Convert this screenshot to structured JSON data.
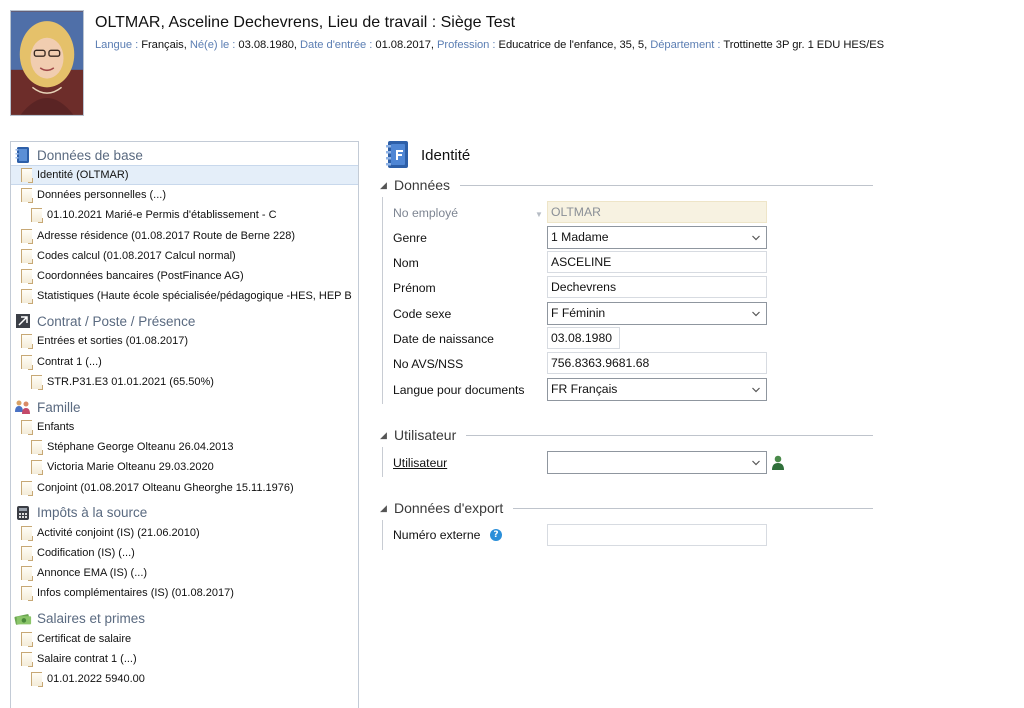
{
  "header": {
    "title": "OLTMAR, Asceline Dechevrens, Lieu de travail : Siège Test",
    "meta": [
      {
        "key": "Langue : ",
        "value": "Français, "
      },
      {
        "key": "Né(e) le : ",
        "value": "03.08.1980, "
      },
      {
        "key": "Date d'entrée : ",
        "value": "01.08.2017, "
      },
      {
        "key": "Profession : ",
        "value": "Educatrice de l'enfance, 35, 5, "
      },
      {
        "key": "Département : ",
        "value": "Trottinette 3P gr. 1 EDU HES/ES"
      }
    ]
  },
  "tree": {
    "groups": [
      {
        "label": "Données de base",
        "icon": "book-icon",
        "items": [
          {
            "label": "Identité (OLTMAR)",
            "level": 0,
            "selected": true
          },
          {
            "label": "Données personnelles (...)",
            "level": 0
          },
          {
            "label": "01.10.2021 Marié-e Permis d'établissement - C",
            "level": 1
          },
          {
            "label": "Adresse résidence (01.08.2017 Route de Berne 228)",
            "level": 0
          },
          {
            "label": "Codes calcul (01.08.2017 Calcul normal)",
            "level": 0
          },
          {
            "label": "Coordonnées bancaires (PostFinance AG)",
            "level": 0
          },
          {
            "label": "Statistiques (Haute école spécialisée/pédagogique -HES, HEP B",
            "level": 0
          }
        ]
      },
      {
        "label": "Contrat / Poste / Présence",
        "icon": "contract-icon",
        "items": [
          {
            "label": "Entrées et sorties (01.08.2017)",
            "level": 0
          },
          {
            "label": "Contrat 1 (...)",
            "level": 0
          },
          {
            "label": "STR.P31.E3 01.01.2021 (65.50%)",
            "level": 1
          }
        ]
      },
      {
        "label": "Famille",
        "icon": "family-icon",
        "items": [
          {
            "label": "Enfants",
            "level": 0
          },
          {
            "label": "Stéphane George Olteanu 26.04.2013",
            "level": 1
          },
          {
            "label": "Victoria Marie Olteanu 29.03.2020",
            "level": 1
          },
          {
            "label": "Conjoint (01.08.2017 Olteanu Gheorghe 15.11.1976)",
            "level": 0
          }
        ]
      },
      {
        "label": "Impôts à la source",
        "icon": "tax-icon",
        "items": [
          {
            "label": "Activité conjoint (IS) (21.06.2010)",
            "level": 0
          },
          {
            "label": "Codification (IS) (...)",
            "level": 0
          },
          {
            "label": "Annonce EMA (IS) (...)",
            "level": 0
          },
          {
            "label": "Infos complémentaires (IS) (01.08.2017)",
            "level": 0
          }
        ]
      },
      {
        "label": "Salaires et primes",
        "icon": "money-icon",
        "items": [
          {
            "label": "Certificat de salaire",
            "level": 0
          },
          {
            "label": "Salaire contrat 1 (...)",
            "level": 0
          },
          {
            "label": "01.01.2022 5940.00",
            "level": 1
          }
        ]
      }
    ]
  },
  "form": {
    "section_title": "Identité",
    "sections": {
      "donnees": "Données",
      "utilisateur": "Utilisateur",
      "export": "Données d'export"
    },
    "fields": {
      "no_employe": {
        "label": "No employé",
        "value": "OLTMAR"
      },
      "genre": {
        "label": "Genre",
        "value": "1 Madame"
      },
      "nom": {
        "label": "Nom",
        "value": "ASCELINE"
      },
      "prenom": {
        "label": "Prénom",
        "value": "Dechevrens"
      },
      "code_sexe": {
        "label": "Code sexe",
        "value": "F Féminin"
      },
      "date_naissance": {
        "label": "Date de naissance",
        "value": "03.08.1980"
      },
      "no_avs": {
        "label": "No AVS/NSS",
        "value": "756.8363.9681.68"
      },
      "langue_docs": {
        "label": "Langue pour documents",
        "value": "FR Français"
      },
      "utilisateur": {
        "label": "Utilisateur",
        "value": ""
      },
      "numero_externe": {
        "label": "Numéro externe",
        "value": ""
      }
    },
    "help_glyph": "?"
  },
  "colors": {
    "accent": "#5b7eb3",
    "selected_row": "#e4eef9",
    "readonly": "#f7f2e1"
  }
}
